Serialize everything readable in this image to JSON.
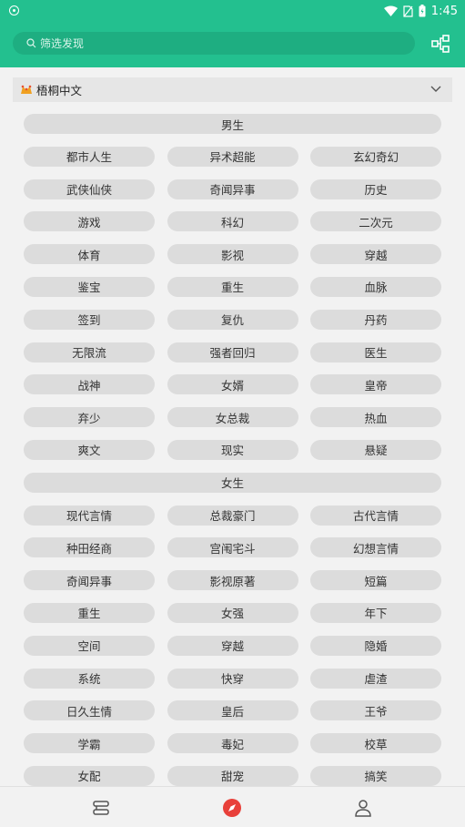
{
  "status": {
    "time": "1:45"
  },
  "search": {
    "placeholder": "筛选发现"
  },
  "source": {
    "name": "梧桐中文"
  },
  "sections": [
    {
      "title": "男生",
      "items": [
        "都市人生",
        "异术超能",
        "玄幻奇幻",
        "武侠仙侠",
        "奇闻异事",
        "历史",
        "游戏",
        "科幻",
        "二次元",
        "体育",
        "影视",
        "穿越",
        "鉴宝",
        "重生",
        "血脉",
        "签到",
        "复仇",
        "丹药",
        "无限流",
        "强者回归",
        "医生",
        "战神",
        "女婿",
        "皇帝",
        "弃少",
        "女总裁",
        "热血",
        "爽文",
        "现实",
        "悬疑"
      ]
    },
    {
      "title": "女生",
      "items": [
        "现代言情",
        "总裁豪门",
        "古代言情",
        "种田经商",
        "宫闱宅斗",
        "幻想言情",
        "奇闻异事",
        "影视原著",
        "短篇",
        "重生",
        "女强",
        "年下",
        "空间",
        "穿越",
        "隐婚",
        "系统",
        "快穿",
        "虐渣",
        "日久生情",
        "皇后",
        "王爷",
        "学霸",
        "毒妃",
        "校草",
        "女配",
        "甜宠",
        "搞笑"
      ]
    }
  ],
  "colors": {
    "accent": "#23c08f",
    "pill": "#dcdcdc",
    "active_nav": "#e8403a"
  },
  "nav": [
    {
      "icon": "bookshelf-icon"
    },
    {
      "icon": "compass-icon",
      "active": true
    },
    {
      "icon": "person-icon"
    }
  ]
}
